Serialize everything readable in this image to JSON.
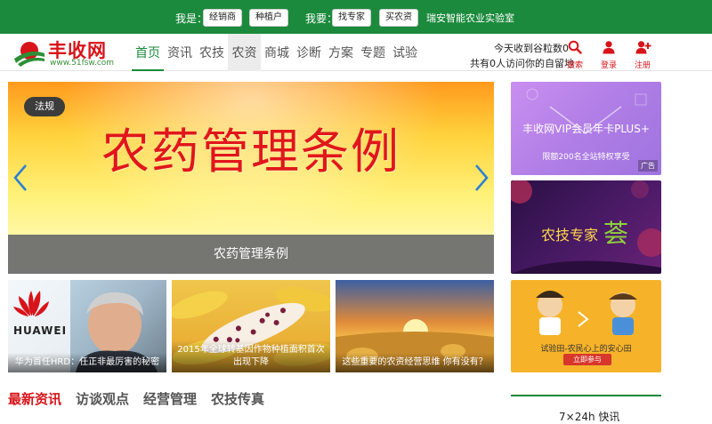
{
  "topbar": {
    "iam_label": "我是：",
    "iam_options": [
      "经销商",
      "种植户"
    ],
    "want_label": "我要：",
    "want_options": [
      "找专家",
      "买农资"
    ],
    "lab_link": "瑞安智能农业实验室"
  },
  "logo": {
    "name": "丰收网",
    "url": "www.51fsw.com"
  },
  "nav": {
    "items": [
      "首页",
      "资讯",
      "农技",
      "农资",
      "商城",
      "诊断",
      "方案",
      "专题",
      "试验"
    ],
    "active_index": 0,
    "hover_index": 3
  },
  "stats": {
    "received": "今天收到谷粒数0",
    "visitors": "共有0人访问你的自留地"
  },
  "actions": [
    {
      "label": "搜索",
      "icon": "search-icon"
    },
    {
      "label": "登录",
      "icon": "user-icon"
    },
    {
      "label": "注册",
      "icon": "user-plus-icon"
    }
  ],
  "slider": {
    "tag": "法规",
    "headline": "农药管理条例",
    "caption": "农药管理条例"
  },
  "thumbs": [
    {
      "caption": "华为首任HRD：任正非最厉害的秘密",
      "logo_text": "HUAWEI"
    },
    {
      "caption": "2015年全球转基因作物种植面积首次出现下降"
    },
    {
      "caption": "这些重要的农资经营思维 你有没有？"
    }
  ],
  "tabs": [
    "最新资讯",
    "访谈观点",
    "经营管理",
    "农技传真"
  ],
  "ads": {
    "vip": {
      "title": "丰收网VIP会员年卡PLUS+",
      "subtitle": "限额200名全站特权享受",
      "badge": "广告"
    },
    "expert": {
      "text": "农技专家",
      "char": "荟"
    },
    "trial": {
      "text": "试验田-农民心上的安心田",
      "button": "立即参与"
    }
  },
  "side_title": "7×24h 快讯",
  "colors": {
    "brand_green": "#1b8a3c",
    "brand_red": "#d7141a"
  }
}
